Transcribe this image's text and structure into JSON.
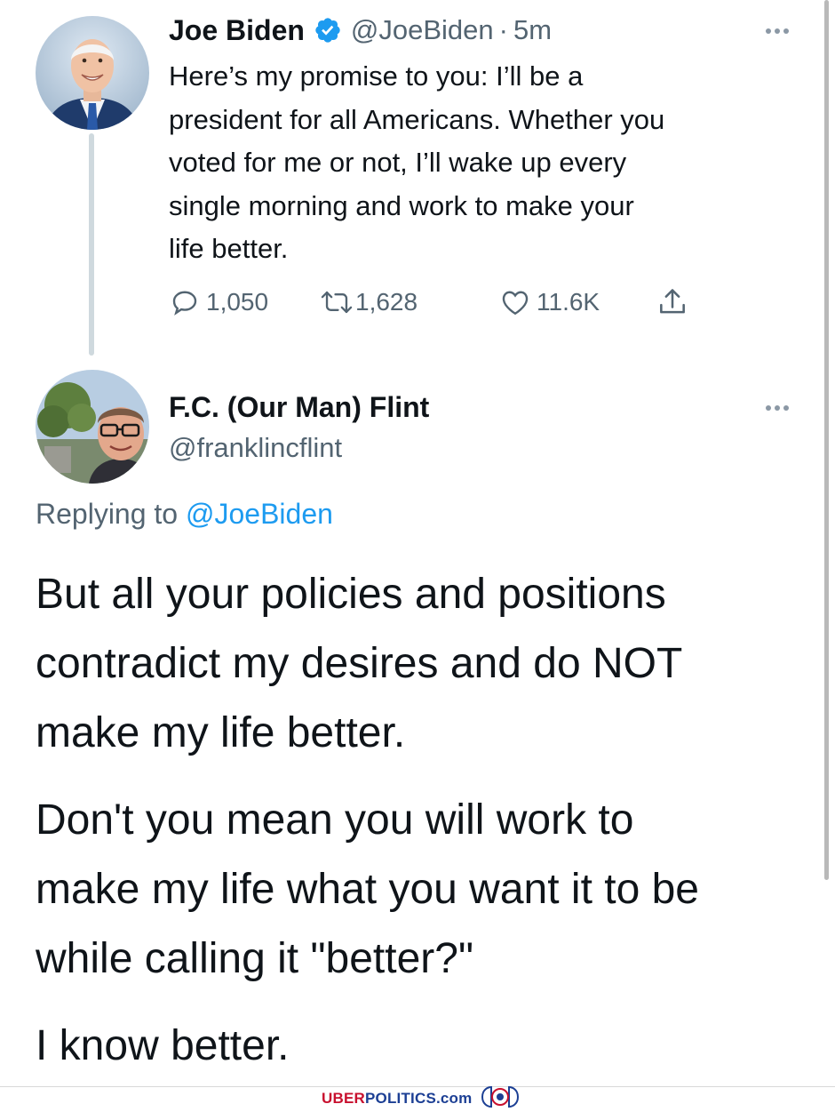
{
  "tweet": {
    "author_name": "Joe Biden",
    "handle": "@JoeBiden",
    "separator": "·",
    "time": "5m",
    "text_lines": [
      "Here’s my promise to you: I’ll be a",
      "president for all Americans. Whether you",
      "voted for me or not, I’ll wake up every",
      "single morning and work to make your",
      "life better."
    ],
    "replies": "1,050",
    "retweets": "1,628",
    "likes": "11.6K",
    "verified_icon": "verified-badge-icon",
    "more_icon": "more-dots-icon"
  },
  "reply": {
    "author_name": "F.C. (Our Man) Flint",
    "handle": "@franklincflint",
    "replying_prefix": "Replying to",
    "replying_to": "@JoeBiden",
    "text_lines": [
      "But all your policies and positions",
      "contradict my desires and do NOT",
      "make my life better.",
      "Don't you mean you will work to",
      "make my life what you want it to be",
      "while calling it \"better?\"",
      "I know better."
    ]
  },
  "watermark": {
    "part1": "UBER",
    "part2": "POLITICS",
    "part3": ".com"
  },
  "colors": {
    "text": "#0f1419",
    "secondary": "#536471",
    "link": "#1d9bf0",
    "verified": "#1d9bf0",
    "brand_red": "#c8102e",
    "brand_blue": "#1c3f94"
  }
}
